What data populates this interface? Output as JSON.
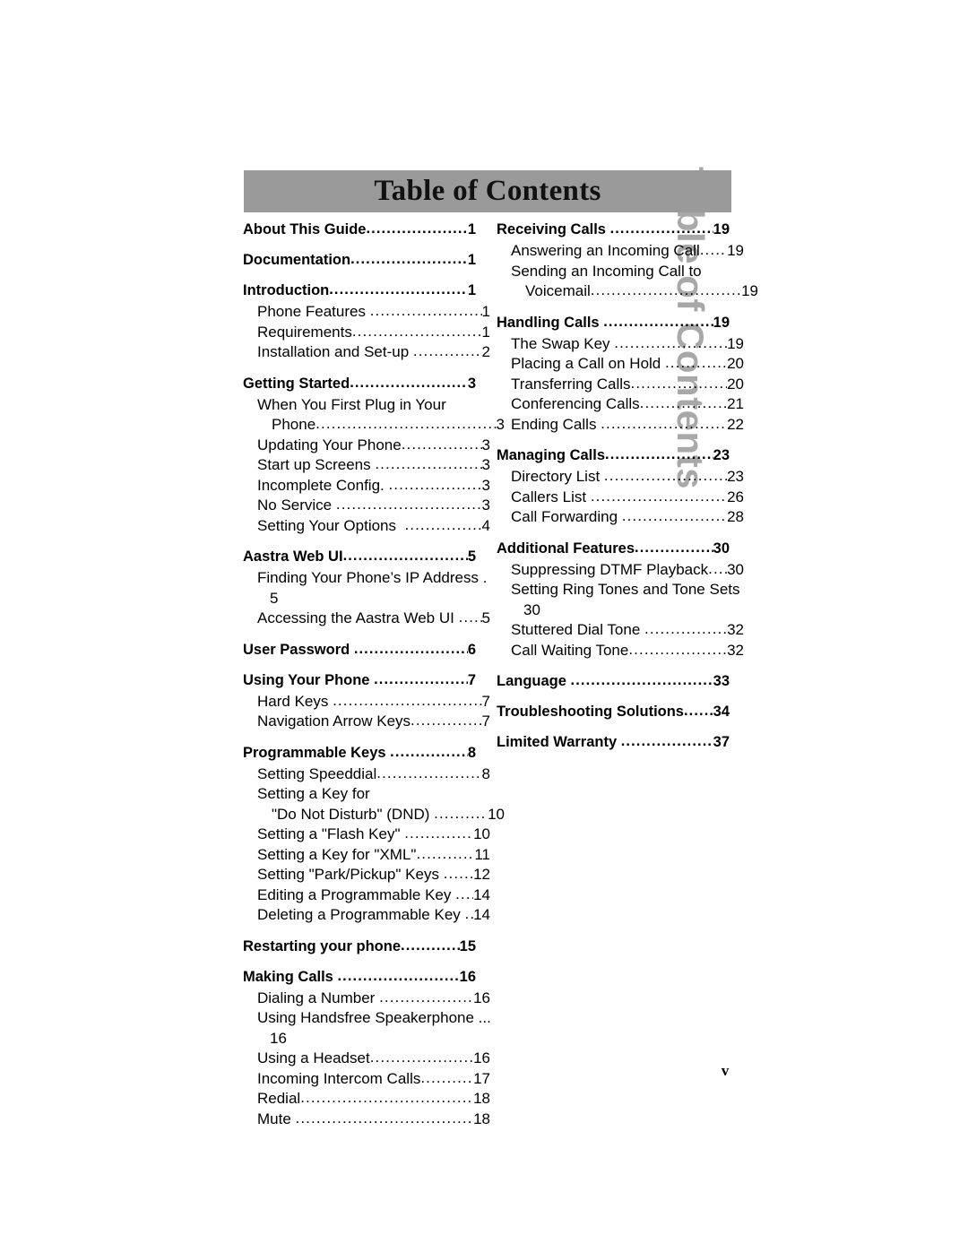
{
  "page": {
    "banner_title": "Table of Contents",
    "vertical_running_head": "Table of Contents",
    "folio": "v",
    "banner_color": "#9a9a9a",
    "vertical_head_color": "#a8a8a8",
    "text_color": "#000000",
    "background_color": "#ffffff"
  },
  "toc": {
    "left_column": [
      {
        "kind": "chapter",
        "label": "About This Guide",
        "page": "1"
      },
      {
        "kind": "chapter",
        "label": "Documentation",
        "page": "1"
      },
      {
        "kind": "chapter",
        "label": "Introduction",
        "page": "1"
      },
      {
        "kind": "entry",
        "label": "Phone Features ",
        "page": "1"
      },
      {
        "kind": "entry",
        "label": "Requirements",
        "page": "1"
      },
      {
        "kind": "entry",
        "label": "Installation and Set-up ",
        "page": "2"
      },
      {
        "kind": "chapter",
        "label": "Getting Started",
        "page": "3"
      },
      {
        "kind": "wrapped",
        "line1": "When You First Plug in Your",
        "line2": "Phone",
        "page": "3"
      },
      {
        "kind": "entry",
        "label": "Updating Your Phone",
        "page": "3"
      },
      {
        "kind": "entry",
        "label": "Start up Screens ",
        "page": "3"
      },
      {
        "kind": "entry",
        "label": "Incomplete Config. ",
        "page": "3"
      },
      {
        "kind": "entry",
        "label": "No Service ",
        "page": "3"
      },
      {
        "kind": "entry",
        "label": "Setting Your Options  ",
        "page": "4"
      },
      {
        "kind": "chapter",
        "label": "Aastra Web UI",
        "page": "5"
      },
      {
        "kind": "orphan",
        "line1": "Finding Your Phone’s IP Address .",
        "page": "5"
      },
      {
        "kind": "entry",
        "label": "Accessing the Aastra Web UI ",
        "page": "5"
      },
      {
        "kind": "chapter",
        "label": "User Password ",
        "page": "6"
      },
      {
        "kind": "chapter",
        "label": "Using Your Phone ",
        "page": "7"
      },
      {
        "kind": "entry",
        "label": "Hard Keys ",
        "page": "7"
      },
      {
        "kind": "entry",
        "label": "Navigation Arrow Keys",
        "page": "7"
      },
      {
        "kind": "chapter",
        "label": "Programmable Keys ",
        "page": "8"
      },
      {
        "kind": "entry",
        "label": "Setting Speeddial",
        "page": "8"
      },
      {
        "kind": "wrapped",
        "line1": "Setting a Key for",
        "line2": "\"Do Not Disturb\" (DND) ",
        "page": "10"
      },
      {
        "kind": "entry",
        "label": "Setting a \"Flash Key\" ",
        "page": "10"
      },
      {
        "kind": "entry",
        "label": "Setting a Key for \"XML\"",
        "page": "11"
      },
      {
        "kind": "entry",
        "label": "Setting \"Park/Pickup\" Keys ",
        "page": "12"
      },
      {
        "kind": "entry",
        "label": "Editing a Programmable Key ",
        "page": "14"
      },
      {
        "kind": "entry",
        "label": "Deleting a Programmable Key ",
        "page": "14"
      },
      {
        "kind": "chapter",
        "label": "Restarting your phone",
        "page": "15"
      },
      {
        "kind": "chapter",
        "label": "Making Calls ",
        "page": "16"
      },
      {
        "kind": "entry",
        "label": "Dialing a Number ",
        "page": "16"
      },
      {
        "kind": "orphan",
        "line1": "Using Handsfree Speakerphone ...",
        "page": "16"
      },
      {
        "kind": "entry",
        "label": "Using a Headset",
        "page": "16"
      },
      {
        "kind": "entry",
        "label": "Incoming Intercom Calls",
        "page": "17"
      },
      {
        "kind": "entry",
        "label": "Redial",
        "page": "18"
      },
      {
        "kind": "entry",
        "label": "Mute ",
        "page": "18"
      }
    ],
    "right_column": [
      {
        "kind": "chapter",
        "label": "Receiving Calls ",
        "page": "19"
      },
      {
        "kind": "entry",
        "label": "Answering an Incoming Call",
        "page": "19"
      },
      {
        "kind": "wrapped",
        "line1": "Sending an Incoming Call to",
        "line2": "Voicemail",
        "page": "19"
      },
      {
        "kind": "chapter",
        "label": "Handling Calls ",
        "page": "19"
      },
      {
        "kind": "entry",
        "label": "The Swap Key ",
        "page": "19"
      },
      {
        "kind": "entry",
        "label": "Placing a Call on Hold ",
        "page": "20"
      },
      {
        "kind": "entry",
        "label": "Transferring Calls",
        "page": "20"
      },
      {
        "kind": "entry",
        "label": "Conferencing Calls",
        "page": "21"
      },
      {
        "kind": "entry",
        "label": "Ending Calls ",
        "page": "22"
      },
      {
        "kind": "chapter",
        "label": "Managing Calls",
        "page": "23"
      },
      {
        "kind": "entry",
        "label": "Directory List ",
        "page": "23"
      },
      {
        "kind": "entry",
        "label": "Callers List ",
        "page": "26"
      },
      {
        "kind": "entry",
        "label": "Call Forwarding ",
        "page": "28"
      },
      {
        "kind": "chapter",
        "label": "Additional Features",
        "page": "30"
      },
      {
        "kind": "entry",
        "label": "Suppressing DTMF Playback",
        "page": "30"
      },
      {
        "kind": "orphan",
        "line1": "Setting Ring Tones and Tone Sets",
        "page": "30"
      },
      {
        "kind": "entry",
        "label": "Stuttered Dial Tone ",
        "page": "32"
      },
      {
        "kind": "entry",
        "label": "Call Waiting Tone",
        "page": "32"
      },
      {
        "kind": "chapter",
        "label": "Language ",
        "page": "33"
      },
      {
        "kind": "chapter",
        "label": "Troubleshooting Solutions",
        "page": "34"
      },
      {
        "kind": "chapter",
        "label": "Limited Warranty ",
        "page": "37"
      }
    ]
  }
}
